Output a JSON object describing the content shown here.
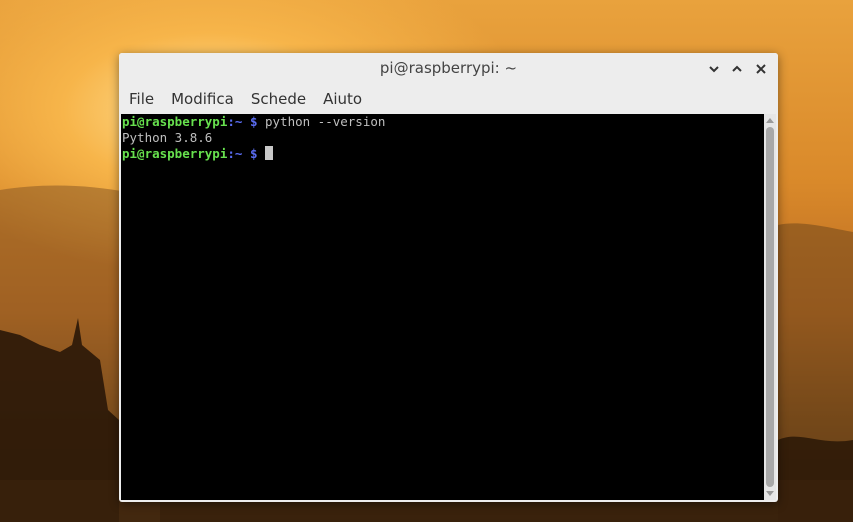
{
  "window": {
    "title": "pi@raspberrypi: ~",
    "controls": [
      "minimize-icon",
      "maximize-icon",
      "close-icon"
    ]
  },
  "menu": {
    "items": [
      "File",
      "Modifica",
      "Schede",
      "Aiuto"
    ]
  },
  "terminal": {
    "lines": [
      {
        "user": "pi@raspberrypi",
        "path": ":~",
        "dollar": " $ ",
        "command": "python --version"
      },
      {
        "output": "Python 3.8.6"
      },
      {
        "user": "pi@raspberrypi",
        "path": ":~",
        "dollar": " $ ",
        "command": ""
      }
    ],
    "colors": {
      "user": "#67e04e",
      "path": "#5a6cf0",
      "text": "#bfbfbf",
      "background": "#000000"
    }
  }
}
